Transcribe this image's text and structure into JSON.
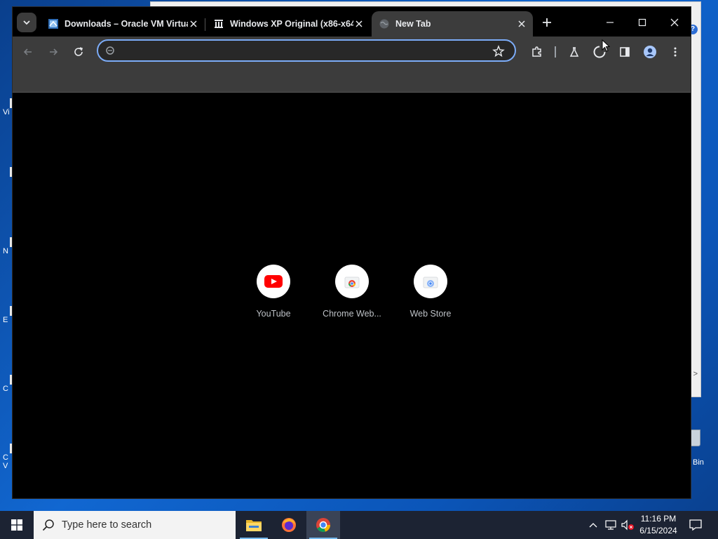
{
  "browser": {
    "tabs": [
      {
        "title": "Downloads – Oracle VM Virtua",
        "active": false
      },
      {
        "title": "Windows XP Original (x86-x64",
        "active": false
      },
      {
        "title": "New Tab",
        "active": true
      }
    ],
    "omnibox": {
      "value": "",
      "placeholder": ""
    },
    "shortcuts": [
      {
        "label": "YouTube",
        "icon": "youtube-icon"
      },
      {
        "label": "Chrome Web...",
        "icon": "chrome-web-store-icon"
      },
      {
        "label": "Web Store",
        "icon": "web-store-icon"
      }
    ]
  },
  "desktop": {
    "recycle_label": "Bin",
    "left_fragments": [
      "Vi",
      "N",
      "E",
      "C",
      "C",
      "V"
    ],
    "help_glyph": "?",
    "chevron_glyph": ">"
  },
  "taskbar": {
    "search_placeholder": "Type here to search",
    "time": "11:16 PM",
    "date": "6/15/2024",
    "apps": [
      "file-explorer-icon",
      "firefox-icon",
      "chrome-icon"
    ]
  },
  "colors": {
    "accent": "#7cacf8",
    "tab_active": "#3c3c3c",
    "taskbar": "#1c2333"
  }
}
